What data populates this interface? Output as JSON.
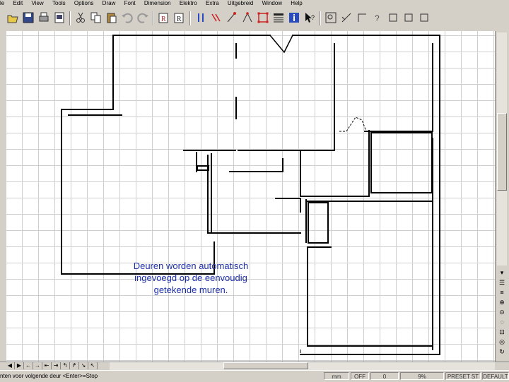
{
  "menu": [
    "le",
    "Edit",
    "View",
    "Tools",
    "Options",
    "Draw",
    "Font",
    "Dimension",
    "Elektro",
    "Extra",
    "Uitgebreid",
    "Window",
    "Help"
  ],
  "toolbar_icons": [
    "open-icon",
    "save-icon",
    "print-icon",
    "preview-icon",
    "cut-icon",
    "copy-icon",
    "paste-icon",
    "undo-icon",
    "redo-icon",
    "reference-icon",
    "reference-icon",
    "pause-icon",
    "parallel-icon",
    "snap-icon",
    "trim-icon",
    "select-rect-icon",
    "list-icon",
    "info-icon",
    "help-pointer-icon",
    "zoom-icon",
    "coordinate-icon",
    "corner-icon",
    "question-icon",
    "square-icon",
    "square-icon",
    "square-icon"
  ],
  "caption": {
    "line1": "Deuren worden automatisch",
    "line2": "ingevoegd op de eenvoudig",
    "line3": "getekende muren."
  },
  "right_tools": [
    "list-icon",
    "layers-icon",
    "pan-icon",
    "zoom-in-icon",
    "zoom-out-icon",
    "zoom-window-icon",
    "zoom-all-icon",
    "redraw-icon",
    "fit-icon"
  ],
  "tabs": [
    "◀",
    "▶",
    "←",
    "→",
    "⇤",
    "⇥",
    "↰",
    "↱",
    "↘",
    "↖"
  ],
  "status": {
    "prompt": "nten voor volgende deur   <Enter>=Stop",
    "unit": "mm",
    "ortho": "OFF",
    "value": "0",
    "zoom": "9%",
    "preset": "PRESET ST",
    "layer": "DEFAULT"
  },
  "colors": {
    "background": "#d4d0c8",
    "grid": "#cfcfcf",
    "caption": "#1c2fa8"
  }
}
